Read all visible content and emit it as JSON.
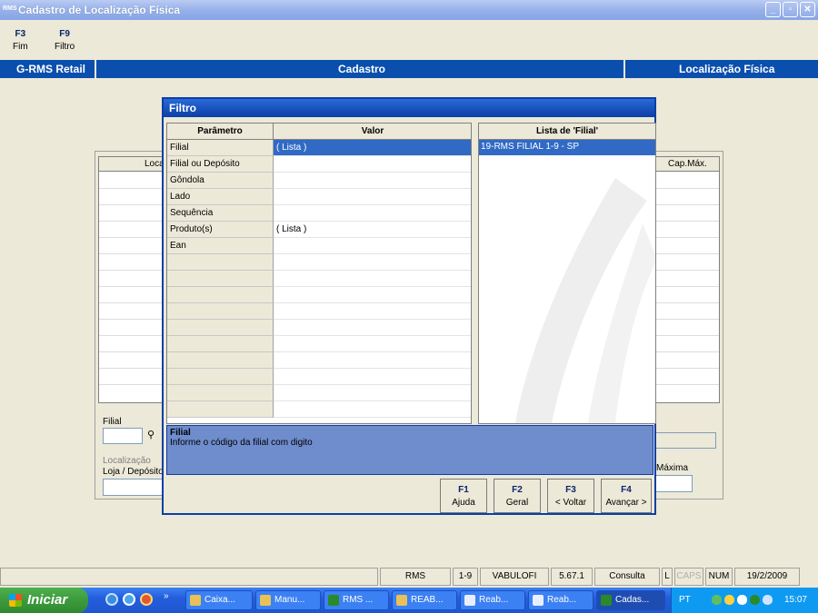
{
  "window": {
    "app_icon": "RMS",
    "title": "Cadastro de Localização Física"
  },
  "fkeys": [
    {
      "key": "F3",
      "label": "Fim"
    },
    {
      "key": "F9",
      "label": "Filtro"
    }
  ],
  "header": {
    "left": "G-RMS Retail",
    "center": "Cadastro",
    "right": "Localização Física"
  },
  "background_form": {
    "grid_col_left": "Loca",
    "grid_col_right": "Cap.Máx.",
    "filial_label": "Filial",
    "localizacao_label": "Localização",
    "loja_label": "Loja / Depósito",
    "maxima_label": "Máxima"
  },
  "dialog": {
    "title": "Filtro",
    "col_param": "Parâmetro",
    "col_valor": "Valor",
    "rows": [
      {
        "param": "Filial",
        "valor": "( Lista )"
      },
      {
        "param": "Filial ou Depósito",
        "valor": ""
      },
      {
        "param": "Gôndola",
        "valor": ""
      },
      {
        "param": "Lado",
        "valor": ""
      },
      {
        "param": "Sequência",
        "valor": ""
      },
      {
        "param": "Produto(s)",
        "valor": "( Lista )"
      },
      {
        "param": "Ean",
        "valor": ""
      }
    ],
    "lista_title": "Lista de 'Filial'",
    "lista_items": [
      "19-RMS FILIAL 1-9 - SP"
    ],
    "help_title": "Filial",
    "help_text": "Informe o código da filial com digito",
    "buttons": [
      {
        "key": "F1",
        "label": "Ajuda"
      },
      {
        "key": "F2",
        "label": "Geral"
      },
      {
        "key": "F3",
        "label": "< Voltar"
      },
      {
        "key": "F4",
        "label": "Avançar >"
      }
    ]
  },
  "statusbar": [
    "RMS",
    "1-9",
    "VABULOFI",
    "5.67.1",
    "Consulta",
    "L",
    "CAPS",
    "NUM",
    "19/2/2009"
  ],
  "taskbar": {
    "start_label": "Iniciar",
    "tasks": [
      "Caixa...",
      "Manu...",
      "RMS ...",
      "REAB...",
      "Reab...",
      "Reab...",
      "Cadas..."
    ],
    "lang": "PT",
    "clock": "15:07"
  },
  "colors": {
    "header_blue": "#0a4fae",
    "selection": "#316ac5",
    "help_bg": "#6f8ccd"
  }
}
